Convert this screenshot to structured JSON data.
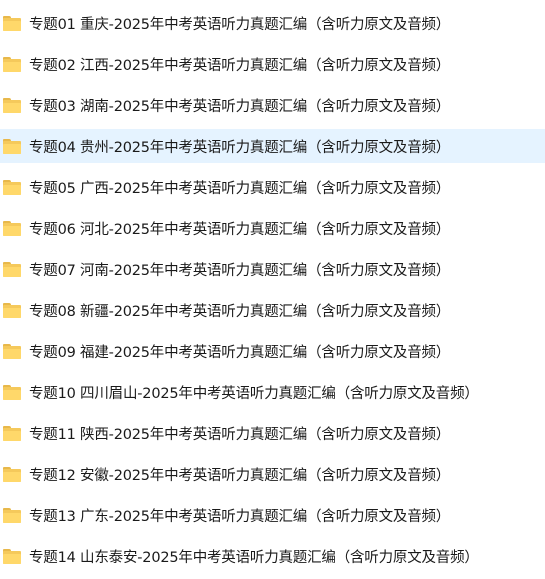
{
  "files": [
    {
      "name": "专题01 重庆-2025年中考英语听力真题汇编（含听力原文及音频）",
      "icon": "folder-icon",
      "selected": false
    },
    {
      "name": "专题02 江西-2025年中考英语听力真题汇编（含听力原文及音频）",
      "icon": "folder-icon",
      "selected": false
    },
    {
      "name": "专题03 湖南-2025年中考英语听力真题汇编（含听力原文及音频）",
      "icon": "folder-icon",
      "selected": false
    },
    {
      "name": "专题04 贵州-2025年中考英语听力真题汇编（含听力原文及音频）",
      "icon": "folder-icon",
      "selected": true
    },
    {
      "name": "专题05 广西-2025年中考英语听力真题汇编（含听力原文及音频）",
      "icon": "folder-icon",
      "selected": false
    },
    {
      "name": "专题06 河北-2025年中考英语听力真题汇编（含听力原文及音频）",
      "icon": "folder-icon",
      "selected": false
    },
    {
      "name": "专题07 河南-2025年中考英语听力真题汇编（含听力原文及音频）",
      "icon": "folder-icon",
      "selected": false
    },
    {
      "name": "专题08 新疆-2025年中考英语听力真题汇编（含听力原文及音频）",
      "icon": "folder-icon",
      "selected": false
    },
    {
      "name": "专题09 福建-2025年中考英语听力真题汇编（含听力原文及音频）",
      "icon": "folder-icon",
      "selected": false
    },
    {
      "name": "专题10 四川眉山-2025年中考英语听力真题汇编（含听力原文及音频）",
      "icon": "folder-icon",
      "selected": false
    },
    {
      "name": "专题11 陕西-2025年中考英语听力真题汇编（含听力原文及音频）",
      "icon": "folder-icon",
      "selected": false
    },
    {
      "name": "专题12 安徽-2025年中考英语听力真题汇编（含听力原文及音频）",
      "icon": "folder-icon",
      "selected": false
    },
    {
      "name": "专题13 广东-2025年中考英语听力真题汇编（含听力原文及音频）",
      "icon": "folder-icon",
      "selected": false
    },
    {
      "name": "专题14 山东泰安-2025年中考英语听力真题汇编（含听力原文及音频）",
      "icon": "folder-icon",
      "selected": false
    }
  ],
  "colors": {
    "selected_row": "#e5f3ff",
    "folder": "#f5c95b",
    "text": "#1a1a1a"
  }
}
